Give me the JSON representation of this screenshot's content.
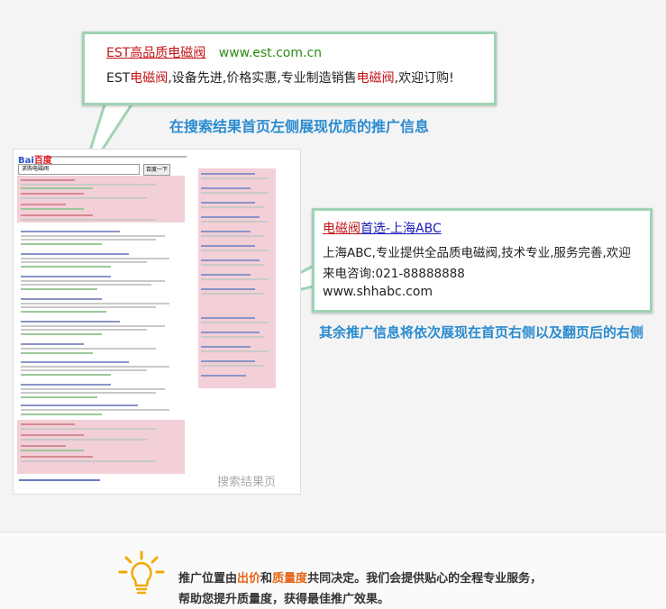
{
  "callout_top": {
    "title": "EST高品质电磁阀",
    "url": "www.est.com.cn",
    "desc_parts": [
      "EST",
      "电磁阀",
      ",设备先进,价格实惠,专业制造销售",
      "电磁阀",
      ",欢迎订购!"
    ]
  },
  "caption_top": "在搜索结果首页左侧展现优质的推广信息",
  "callout_right": {
    "title_hl": "电磁阀",
    "title_rest": "首选-上海ABC",
    "desc_line1": "上海ABC,专业提供全品质电磁阀,技术专业,服务完善,欢迎",
    "desc_line2": "来电咨询:021-88888888",
    "url": "www.shhabc.com"
  },
  "caption_right": "其余推广信息将依次展现在首页右侧以及翻页后的右侧",
  "serp": {
    "logo_letters": "Bai",
    "logo_rest": "百度",
    "query": "求购电磁阀",
    "search_button": "百度一下",
    "page_label": "搜索结果页"
  },
  "bottom_note": {
    "line1_a": "推广位置由",
    "line1_b": "出价",
    "line1_c": "和",
    "line1_d": "质量度",
    "line1_e": "共同决定。我们会提供贴心的全程专业服务，",
    "line2": "帮助您提升质量度，获得最佳推广效果。"
  },
  "colors": {
    "accent": "#2a8bcf",
    "highlight": "#c21418",
    "card_border": "#9fd3b4",
    "bulb": "#f2a900"
  }
}
